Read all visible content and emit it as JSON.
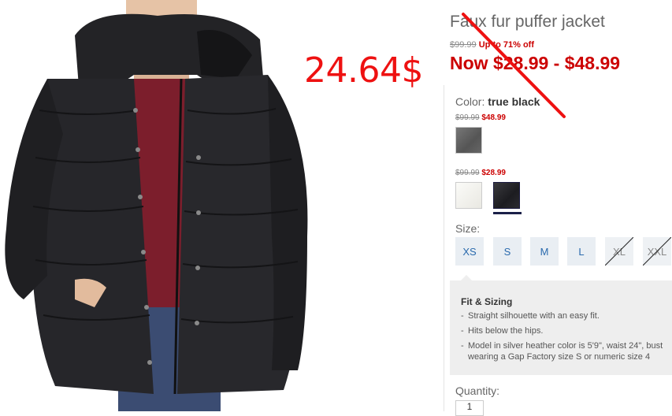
{
  "overlay_price": "24.64$",
  "product": {
    "title": "Faux fur puffer jacket",
    "was_price": "$99.99",
    "discount": "Up to 71% off",
    "now_price": "Now $28.99 - $48.99"
  },
  "color": {
    "label": "Color:",
    "selected": "true black",
    "groups": [
      {
        "was": "$99.99",
        "sale": "$48.99"
      },
      {
        "was": "$99.99",
        "sale": "$28.99"
      }
    ]
  },
  "size": {
    "label": "Size:",
    "options": [
      {
        "label": "XS",
        "available": true
      },
      {
        "label": "S",
        "available": true
      },
      {
        "label": "M",
        "available": true
      },
      {
        "label": "L",
        "available": true
      },
      {
        "label": "XL",
        "available": false
      },
      {
        "label": "XXL",
        "available": false
      }
    ]
  },
  "fit": {
    "title": "Fit & Sizing",
    "items": [
      "Straight silhouette with an easy fit.",
      "Hits below the hips.",
      "Model in silver heather color is 5'9\", waist 24\", bust",
      "wearing a Gap Factory size S or numeric size 4"
    ]
  },
  "quantity": {
    "label": "Quantity:",
    "value": "1"
  },
  "colors": {
    "sale_red": "#cc0000",
    "overlay_red": "#ee1111",
    "link_blue": "#2a6aad"
  }
}
